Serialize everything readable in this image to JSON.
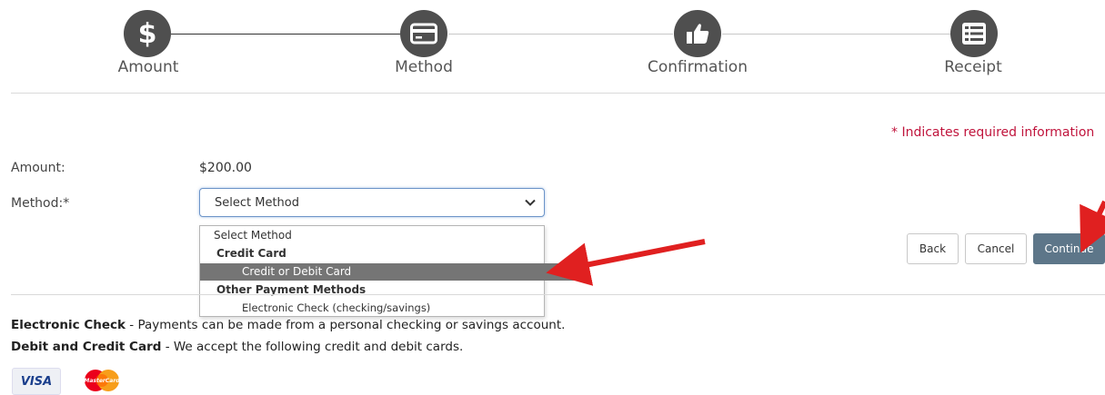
{
  "stepper": {
    "steps": [
      {
        "label": "Amount",
        "icon": "dollar-icon"
      },
      {
        "label": "Method",
        "icon": "credit-card-icon"
      },
      {
        "label": "Confirmation",
        "icon": "thumbs-up-icon"
      },
      {
        "label": "Receipt",
        "icon": "list-icon"
      }
    ],
    "current_step": 2
  },
  "required_note": "* Indicates required information",
  "form": {
    "amount_label": "Amount:",
    "amount_value": "$200.00",
    "method_label": "Method:*",
    "method_selected": "Select Method",
    "method_options": {
      "placeholder": "Select Method",
      "group_credit": "Credit Card",
      "credit_or_debit": "Credit or Debit Card",
      "group_other": "Other Payment Methods",
      "echeck": "Electronic Check (checking/savings)"
    }
  },
  "buttons": {
    "back": "Back",
    "cancel": "Cancel",
    "continue": "Continue"
  },
  "info": {
    "echeck_title": "Electronic Check",
    "echeck_text": " - Payments can be made from a personal checking or savings account.",
    "card_title": "Debit and Credit Card",
    "card_text": " - We accept the following credit and debit cards."
  },
  "cards": {
    "visa": "VISA",
    "mastercard": "MasterCard"
  },
  "colors": {
    "step_circle": "#4f4f4f",
    "required_red": "#c0143c",
    "selected_option": "#757575",
    "continue_button": "#5d7689",
    "annotation_arrow": "#e02020"
  }
}
